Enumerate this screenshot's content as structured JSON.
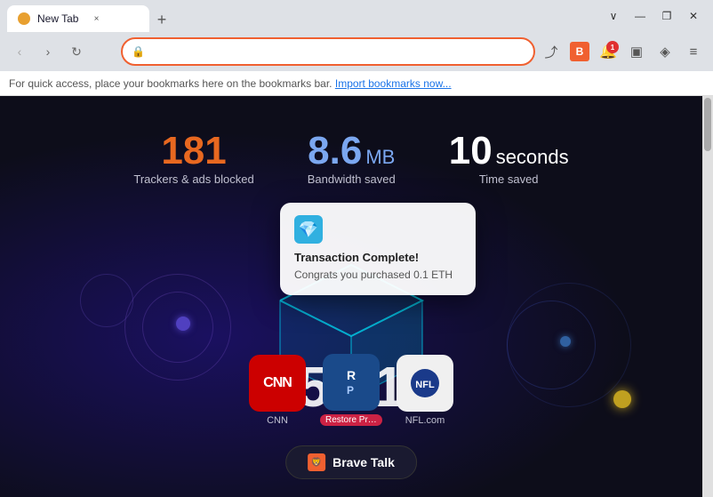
{
  "browser": {
    "tab_title": "New Tab",
    "tab_close": "×",
    "new_tab": "+",
    "window_minimize": "—",
    "window_maximize": "❐",
    "window_close": "✕",
    "chevron_down": "∨",
    "back_arrow": "‹",
    "forward_arrow": "›",
    "refresh": "↻",
    "bookmark": "☆",
    "address_url": "",
    "address_placeholder": "",
    "share_icon": "⤴",
    "menu_icon": "≡",
    "wallet_icon": "◈",
    "sidebar_icon": "▣",
    "bookmark_bar_text": "For quick access, place your bookmarks here on the bookmarks bar.",
    "import_link": "Import bookmarks now...",
    "notification_count": "1"
  },
  "new_tab": {
    "stats": {
      "trackers": {
        "number": "181",
        "label": "Trackers & ads blocked"
      },
      "bandwidth": {
        "number": "8.6",
        "unit": "MB",
        "label": "Bandwidth saved"
      },
      "time": {
        "number": "10",
        "unit": "seconds",
        "label": "Time saved"
      }
    },
    "popup": {
      "title": "Transaction Complete!",
      "body": "Congrats you purchased 0.1 ETH"
    },
    "big_number": "5.11",
    "shortcuts": [
      {
        "name": "CNN",
        "label": "CNN",
        "type": "cnn"
      },
      {
        "name": "Restore Priv...",
        "label": "Restore Priv...",
        "type": "rp"
      },
      {
        "name": "NFL.com",
        "label": "NFL.com",
        "type": "nfl"
      }
    ],
    "brave_talk_label": "Brave Talk"
  }
}
